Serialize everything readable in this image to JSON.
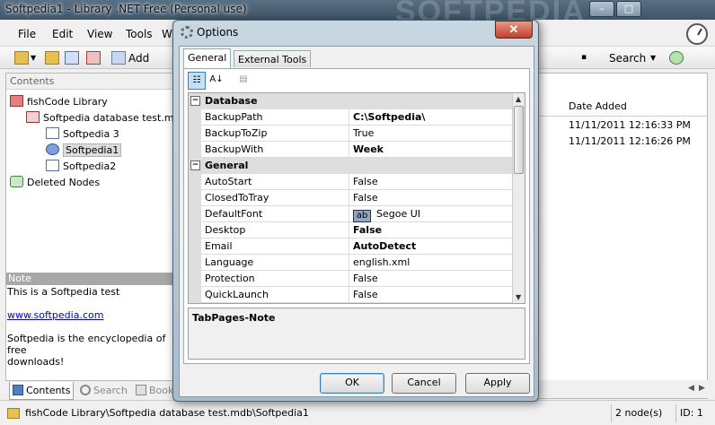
{
  "main_window": {
    "title": "Softpedia1 - Library .NET Free (Personal  use)",
    "watermark": "SOFTPEDIA",
    "caption_buttons": {
      "minimize": "–",
      "maximize": "□",
      "close": "✕"
    },
    "menu": [
      "File",
      "Edit",
      "View",
      "Tools",
      "W"
    ],
    "toolbar": {
      "add_label": "Add",
      "search_label": "Search"
    }
  },
  "left_pane": {
    "header": "Contents",
    "tree": [
      {
        "label": "fishCode Library",
        "icon": "library-icon"
      },
      {
        "label": "Softpedia database test.mdb",
        "icon": "database-icon"
      },
      {
        "label": "Softpedia 3",
        "icon": "table-icon"
      },
      {
        "label": "Softpedia1",
        "icon": "table-icon",
        "selected": true
      },
      {
        "label": "Softpedia2",
        "icon": "table-icon"
      },
      {
        "label": "Deleted Nodes",
        "icon": "recycle-icon"
      }
    ],
    "note": {
      "header": "Note",
      "line1": "This is a Softpedia test",
      "link": "www.softpedia.com",
      "line3a": "Softpedia is the encyclopedia of free",
      "line3b": "downloads!"
    },
    "tabs": [
      "Contents",
      "Search",
      "Book"
    ]
  },
  "right_pane": {
    "column_header": "Date Added",
    "rows": [
      "11/11/2011 12:16:33 PM",
      "11/11/2011 12:16:26 PM"
    ]
  },
  "statusbar": {
    "path": "fishCode Library\\Softpedia database test.mdb\\Softpedia1",
    "nodes": "2 node(s)",
    "id": "ID: 1"
  },
  "options_dialog": {
    "title": "Options",
    "tabs": [
      "General",
      "External Tools"
    ],
    "active_tab": "General",
    "sort_buttons": [
      "categorized",
      "alphabetical",
      "property-pages"
    ],
    "categories": [
      {
        "name": "Database",
        "properties": [
          {
            "name": "BackupPath",
            "value": "C:\\Softpedia\\",
            "bold": true
          },
          {
            "name": "BackupToZip",
            "value": "True",
            "bold": false
          },
          {
            "name": "BackupWith",
            "value": "Week",
            "bold": true
          }
        ]
      },
      {
        "name": "General",
        "properties": [
          {
            "name": "AutoStart",
            "value": "False",
            "bold": false
          },
          {
            "name": "ClosedToTray",
            "value": "False",
            "bold": false
          },
          {
            "name": "DefaultFont",
            "value": "Segoe UI",
            "bold": false,
            "font_sample": "ab"
          },
          {
            "name": "Desktop",
            "value": "False",
            "bold": true
          },
          {
            "name": "Email",
            "value": "AutoDetect",
            "bold": true
          },
          {
            "name": "Language",
            "value": "english.xml",
            "bold": false
          },
          {
            "name": "Protection",
            "value": "False",
            "bold": false
          },
          {
            "name": "QuickLaunch",
            "value": "False",
            "bold": false
          }
        ]
      }
    ],
    "description_title": "TabPages-Note",
    "buttons": {
      "ok": "OK",
      "cancel": "Cancel",
      "apply": "Apply"
    }
  }
}
